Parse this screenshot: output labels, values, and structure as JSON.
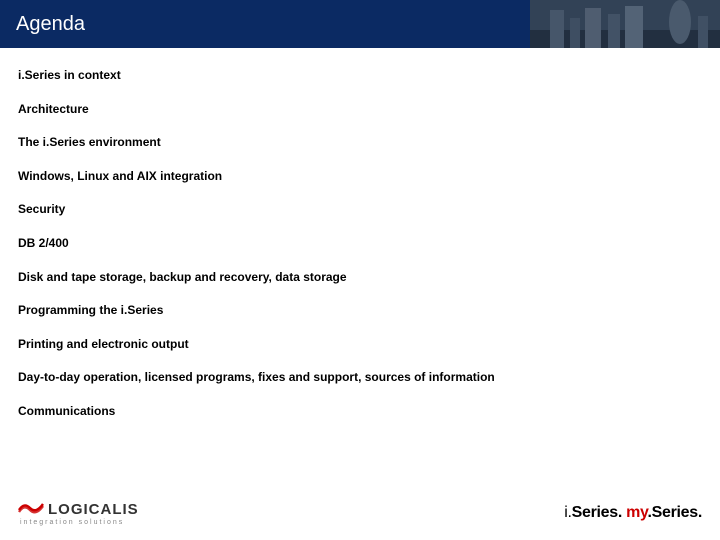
{
  "header": {
    "title": "Agenda"
  },
  "agenda": {
    "items": [
      "i.Series in context",
      "Architecture",
      "The i.Series environment",
      "Windows, Linux and AIX integration",
      "Security",
      "DB 2/400",
      "Disk and tape storage, backup and recovery, data storage",
      "Programming the i.Series",
      "Printing and electronic output",
      "Day-to-day operation, licensed programs, fixes and support, sources of information",
      "Communications"
    ]
  },
  "footer": {
    "brand_name": "LOGICALIS",
    "tagline": "integration solutions",
    "right_series_i": "i.",
    "right_series_text": "Series. ",
    "right_my": "my",
    "right_series_text2": ".Series."
  }
}
